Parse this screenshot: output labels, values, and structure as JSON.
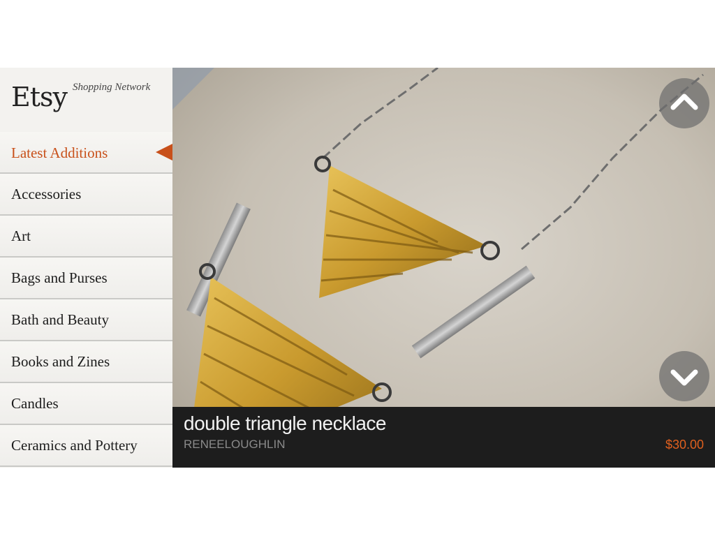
{
  "brand": {
    "logo": "Etsy",
    "subtitle": "Shopping Network"
  },
  "menu": {
    "items": [
      {
        "label": "Latest Additions",
        "active": true
      },
      {
        "label": "Accessories"
      },
      {
        "label": "Art"
      },
      {
        "label": "Bags and Purses"
      },
      {
        "label": "Bath and Beauty"
      },
      {
        "label": "Books and Zines"
      },
      {
        "label": "Candles"
      },
      {
        "label": "Ceramics and Pottery"
      }
    ]
  },
  "item": {
    "title": "double triangle necklace",
    "seller": "RENEELOUGHLIN",
    "price": "$30.00"
  },
  "colors": {
    "accent": "#c8501a",
    "caption_bg": "#1d1d1d",
    "price": "#e0601e"
  },
  "icons": {
    "up": "chevron-up-icon",
    "down": "chevron-down-icon"
  }
}
